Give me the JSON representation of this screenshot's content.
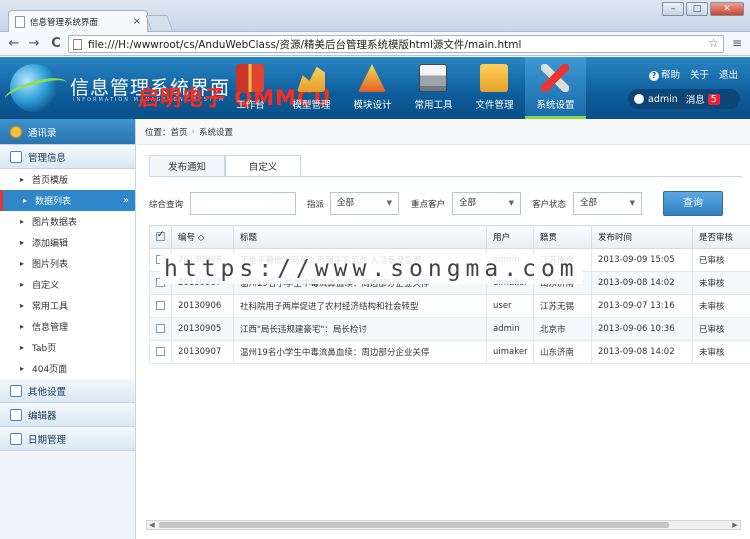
{
  "browser": {
    "tab_title": "信息管理系统界面",
    "tab_close": "×",
    "url": "file:///H:/wwwroot/cs/AnduWebClass/资源/精美后台管理系统模版html源文件/main.html",
    "win_min": "–",
    "win_max": "□",
    "win_close": "✕",
    "back": "←",
    "forward": "→",
    "reload": "C",
    "star": "☆",
    "menu": "≡"
  },
  "header": {
    "title": "信息管理系统界面",
    "subtitle": "INFORMATION MANAGEMENT SYSTEM",
    "watermark": "启明电子 QMMCU",
    "nav": [
      {
        "label": "工作台",
        "icon": "book-icon"
      },
      {
        "label": "模型管理",
        "icon": "chart-icon"
      },
      {
        "label": "模块设计",
        "icon": "design-tools-icon"
      },
      {
        "label": "常用工具",
        "icon": "printer-icon"
      },
      {
        "label": "文件管理",
        "icon": "folder-icon"
      },
      {
        "label": "系统设置",
        "icon": "tools-icon"
      }
    ],
    "help": "帮助",
    "about": "关于",
    "logout": "退出",
    "user": "admin",
    "messages_label": "消息",
    "messages_count": "5"
  },
  "sidebar": {
    "top": "通讯录",
    "section_info": "管理信息",
    "items": [
      "首页模版",
      "数据列表",
      "图片数据表",
      "添加编辑",
      "图片列表",
      "自定义",
      "常用工具",
      "信息管理",
      "Tab页",
      "404页面"
    ],
    "other": "其他设置",
    "editor": "编辑器",
    "date": "日期管理"
  },
  "main": {
    "crumb_label": "位置：",
    "crumb_home": "首页",
    "crumb_current": "系统设置",
    "tabs": [
      "发布通知",
      "自定义"
    ],
    "filters": {
      "search_label": "综合查询",
      "search_value": "",
      "assign_label": "指派",
      "assign_value": "全部",
      "key_label": "重点客户",
      "key_value": "全部",
      "status_label": "客户状态",
      "status_value": "全部",
      "query_button": "查询"
    },
    "table": {
      "headers": [
        "编号 ◇",
        "标题",
        "用户",
        "籍贯",
        "发布时间",
        "是否审核"
      ],
      "rows": [
        {
          "id": "20130908",
          "title": "王金平幕僚：马英九声明字字见血 人活着没意思",
          "user": "admin",
          "origin": "江苏南京",
          "time": "2013-09-09 15:05",
          "status": "已审核"
        },
        {
          "id": "20130907",
          "title": "温州19名小学生中毒流鼻血续：周边部分企业关停",
          "user": "uimaker",
          "origin": "山东济南",
          "time": "2013-09-08 14:02",
          "status": "未审核"
        },
        {
          "id": "20130906",
          "title": "社科院用子两岸促进了农村经济结构和社会转型",
          "user": "user",
          "origin": "江苏无锡",
          "time": "2013-09-07 13:16",
          "status": "未审核"
        },
        {
          "id": "20130905",
          "title": "江西\"局长违规建豪宅\"：局长检讨",
          "user": "admin",
          "origin": "北京市",
          "time": "2013-09-06 10:36",
          "status": "已审核"
        },
        {
          "id": "20130907",
          "title": "温州19名小学生中毒流鼻血续：周边部分企业关停",
          "user": "uimaker",
          "origin": "山东济南",
          "time": "2013-09-08 14:02",
          "status": "未审核"
        }
      ]
    }
  },
  "watermark_url": "https://www.songma.com"
}
